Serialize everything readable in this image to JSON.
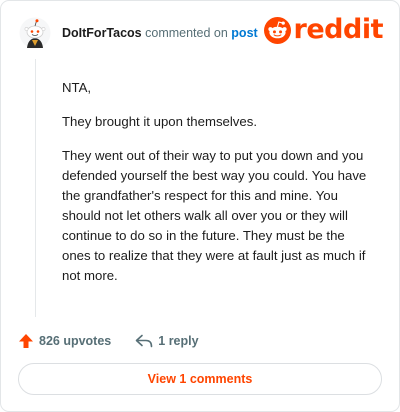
{
  "comment": {
    "username": "DoItForTacos",
    "action_text": "commented on",
    "post_link": "post",
    "paragraphs": [
      "NTA,",
      "They brought it upon themselves.",
      "They went out of their way to put you down and you defended yourself the best way you could. You have the grandfather's respect for this and mine. You should not let others walk all over you or they will continue to do so in the future. They must be the ones to realize that they were at fault just as much if not more."
    ]
  },
  "brand": {
    "logo_text": "reddit",
    "color": "#ff4500"
  },
  "actions": {
    "upvotes": "826 upvotes",
    "replies": "1 reply"
  },
  "footer": {
    "view_button": "View 1 comments"
  },
  "icons": {
    "avatar": "snoo-avatar-icon",
    "logo": "reddit-alien-icon",
    "upvote": "upvote-arrow-icon",
    "reply": "reply-arrow-icon"
  }
}
